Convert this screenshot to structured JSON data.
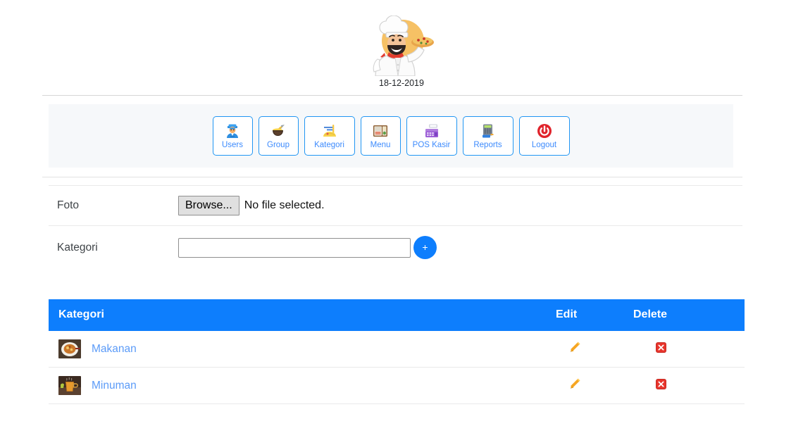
{
  "brand": {
    "logo_icon": "chef-pizza-logo",
    "date": "18-12-2019"
  },
  "nav": {
    "items": [
      {
        "label": "Users",
        "icon": "user-worker-icon"
      },
      {
        "label": "Group",
        "icon": "bowl-with-spoon-icon"
      },
      {
        "label": "Kategori",
        "icon": "spaghetti-icon"
      },
      {
        "label": "Menu",
        "icon": "bento-box-icon"
      },
      {
        "label": "POS Kasir",
        "icon": "cash-register-icon"
      },
      {
        "label": "Reports",
        "icon": "calculator-icon"
      },
      {
        "label": "Logout",
        "icon": "power-icon"
      }
    ]
  },
  "form": {
    "foto_label": "Foto",
    "browse_label": "Browse...",
    "file_status": "No file selected.",
    "kategori_label": "Kategori",
    "kategori_value": "",
    "kategori_placeholder": "",
    "add_label": "+"
  },
  "table": {
    "columns": [
      "Kategori",
      "Edit",
      "Delete"
    ],
    "rows": [
      {
        "name": "Makanan",
        "thumb": "soup-bowl-photo",
        "edit_icon": "pencil-icon",
        "delete_icon": "red-x-icon"
      },
      {
        "name": "Minuman",
        "thumb": "iced-tea-photo",
        "edit_icon": "pencil-icon",
        "delete_icon": "red-x-icon"
      }
    ]
  },
  "colors": {
    "primary": "#0d7efd",
    "nav_border": "#2196f3",
    "nav_label": "#3d8bfd",
    "panel_bg": "#f6f8fa",
    "link": "#5b9bf8",
    "delete": "#e8352c",
    "edit": "#f5a623"
  }
}
